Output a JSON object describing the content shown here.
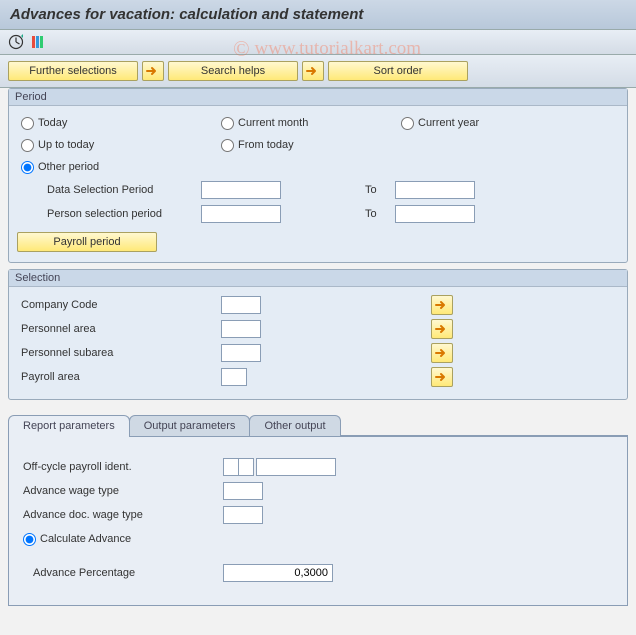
{
  "title": "Advances for vacation: calculation and statement",
  "toolbar": {
    "further": "Further selections",
    "search": "Search helps",
    "sort": "Sort order"
  },
  "period": {
    "title": "Period",
    "today": "Today",
    "current_month": "Current month",
    "current_year": "Current year",
    "up_to_today": "Up to today",
    "from_today": "From today",
    "other_period": "Other period",
    "data_sel": "Data Selection Period",
    "person_sel": "Person selection period",
    "to": "To",
    "payroll_btn": "Payroll period",
    "data_from": "",
    "data_to": "",
    "person_from": "",
    "person_to": ""
  },
  "selection": {
    "title": "Selection",
    "company": "Company Code",
    "pers_area": "Personnel area",
    "pers_subarea": "Personnel subarea",
    "payroll_area": "Payroll area",
    "company_val": "",
    "pers_area_val": "",
    "pers_subarea_val": "",
    "payroll_area_val": ""
  },
  "tabs": {
    "report": "Report parameters",
    "output": "Output parameters",
    "other": "Other output"
  },
  "report": {
    "offcycle": "Off-cycle payroll ident.",
    "adv_wage": "Advance wage type",
    "adv_doc": "Advance doc. wage type",
    "calc": "Calculate Advance",
    "adv_pct": "Advance Percentage",
    "offcycle_a": "",
    "offcycle_b": "",
    "offcycle_c": "",
    "adv_wage_val": "",
    "adv_doc_val": "",
    "adv_pct_val": "0,3000"
  },
  "watermark": "www.tutorialkart.com"
}
